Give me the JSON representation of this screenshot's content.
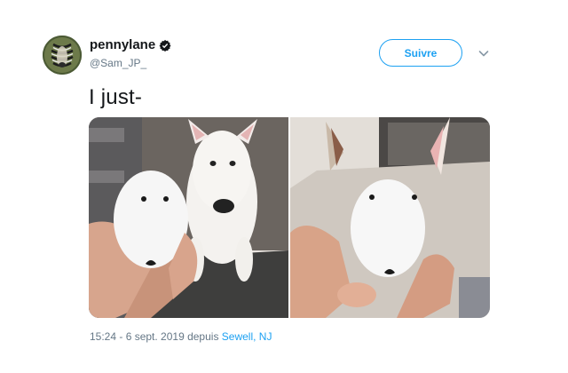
{
  "author": {
    "display_name": "pennylane",
    "handle": "@Sam_JP_",
    "verified_icon": "verified-badge-icon",
    "avatar": "zebra-avatar"
  },
  "follow_button": {
    "label": "Suivre"
  },
  "menu": {
    "icon": "chevron-down-icon"
  },
  "tweet": {
    "text": "I just-",
    "media": [
      {
        "name": "egg-with-dog-face-photo-1"
      },
      {
        "name": "egg-with-dog-face-photo-2"
      }
    ]
  },
  "meta": {
    "time": "15:24 - 6 sept. 2019 depuis ",
    "location": "Sewell, NJ"
  },
  "colors": {
    "accent": "#1da1f2",
    "text": "#14171a",
    "muted": "#657786"
  }
}
